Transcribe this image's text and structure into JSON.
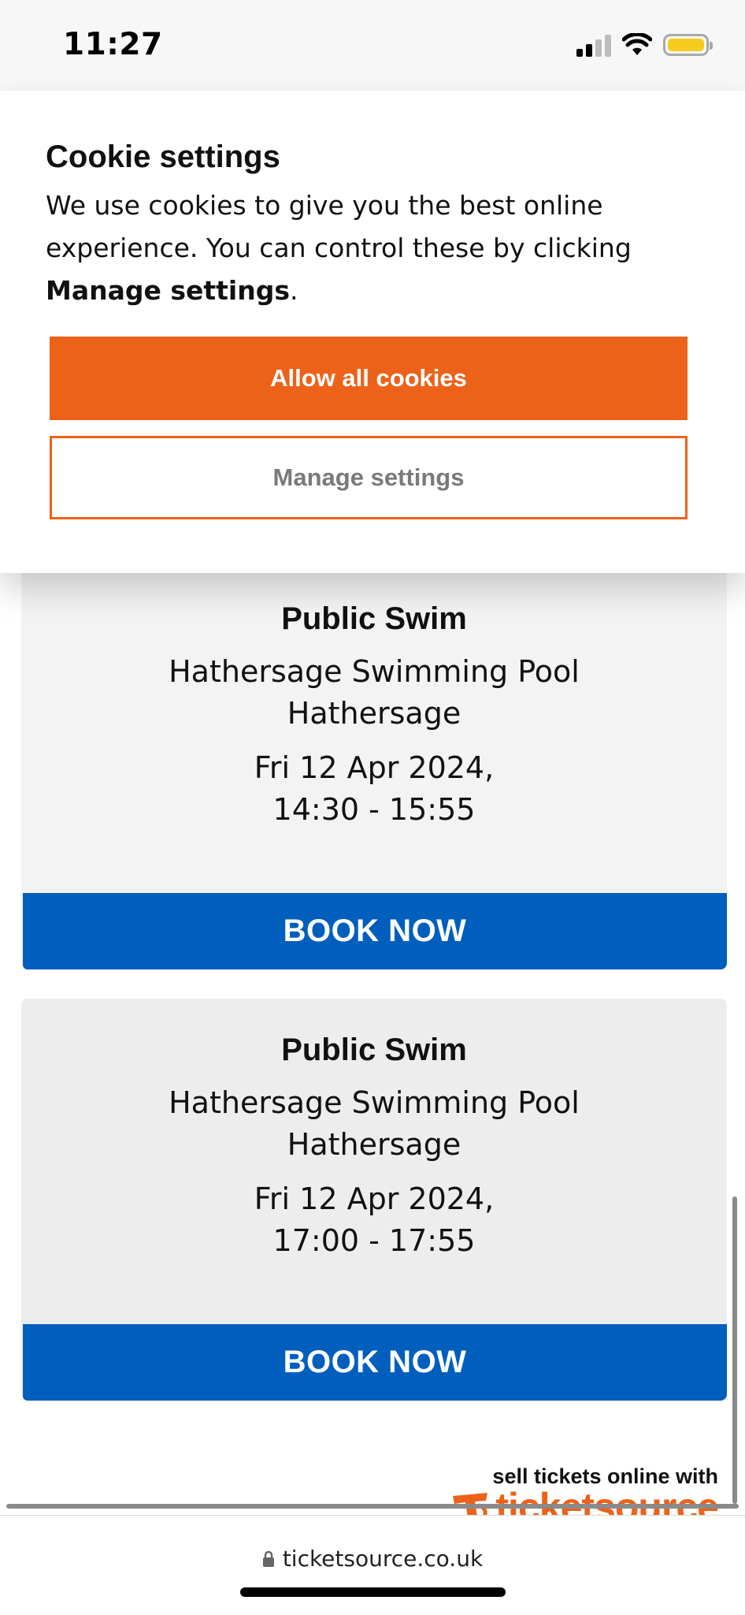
{
  "status_bar": {
    "time": "11:27"
  },
  "cookie_banner": {
    "title": "Cookie settings",
    "text_before": "We use cookies to give you the best online experience. You can control these by clicking ",
    "text_link": "Manage settings",
    "text_after": ".",
    "allow_label": "Allow all cookies",
    "manage_label": "Manage settings"
  },
  "events": [
    {
      "title": "Public Swim",
      "venue": "Hathersage Swimming Pool",
      "town": "Hathersage",
      "date": "Fri 12 Apr 2024,",
      "time": "14:30 - 15:55",
      "button_label": "BOOK NOW"
    },
    {
      "title": "Public Swim",
      "venue": "Hathersage Swimming Pool",
      "town": "Hathersage",
      "date": "Fri 12 Apr 2024,",
      "time": "17:00 - 17:55",
      "button_label": "BOOK NOW"
    }
  ],
  "brand": {
    "tagline": "sell tickets online with",
    "name": "ticketsource"
  },
  "browser": {
    "url": "ticketsource.co.uk"
  },
  "colors": {
    "accent_orange": "#ec6219",
    "book_blue": "#005ebd",
    "battery_yellow": "#f5cc1d"
  }
}
